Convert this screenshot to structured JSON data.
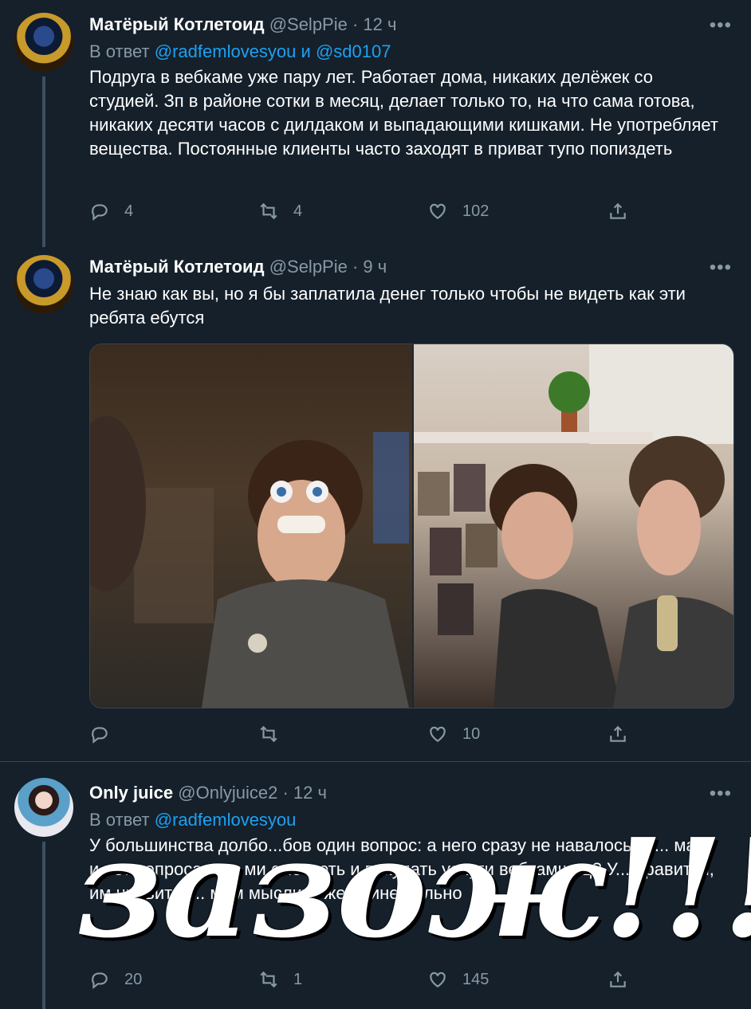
{
  "tweets": [
    {
      "author": "Матёрый Котлетоид",
      "handle": "@SelpPie",
      "time": "· 12 ч",
      "more": "•••",
      "reply_prefix": "В ответ",
      "reply_user1": "@radfemlovesyou",
      "reply_and": "и",
      "reply_user2": "@sd0107",
      "text": "Подруга в вебкаме уже пару лет. Работает дома, никаких делёжек со студией. Зп в районе сотки в месяц, делает только то, на что сама готова, никаких десяти часов с дилдаком и выпадающими кишками. Не употребляет вещества. Постоянные клиенты часто заходят в приват тупо попиздеть",
      "replies": "4",
      "retweets": "4",
      "likes": "102"
    },
    {
      "author": "Матёрый Котлетоид",
      "handle": "@SelpPie",
      "time": "· 9 ч",
      "more": "•••",
      "text": "Не знаю как вы, но я бы заплатила денег только чтобы не видеть как эти ребята ебутся",
      "replies": "",
      "retweets": "",
      "likes": "10"
    },
    {
      "author": "Only juice",
      "handle": "@Onlyjuice2",
      "time": "· 12 ч",
      "more": "•••",
      "reply_prefix": "В ответ",
      "reply_user1": "@radfemlovesyou",
      "text": "У большинства долбо...бов один вопрос: а него сразу не навалось за... мать и нет вопроса за... ми смотреть и покупать услуги вебкамщиц? У... нравится, им нравится... мам мыслить женщине больно",
      "replies": "20",
      "retweets": "1",
      "likes": "145"
    }
  ],
  "overlay_text": "зазож!!!",
  "icons": [
    "reply-icon",
    "retweet-icon",
    "like-icon",
    "share-icon"
  ],
  "colors": {
    "background": "#15202b",
    "link": "#1da1f2",
    "muted": "#8899a6"
  }
}
